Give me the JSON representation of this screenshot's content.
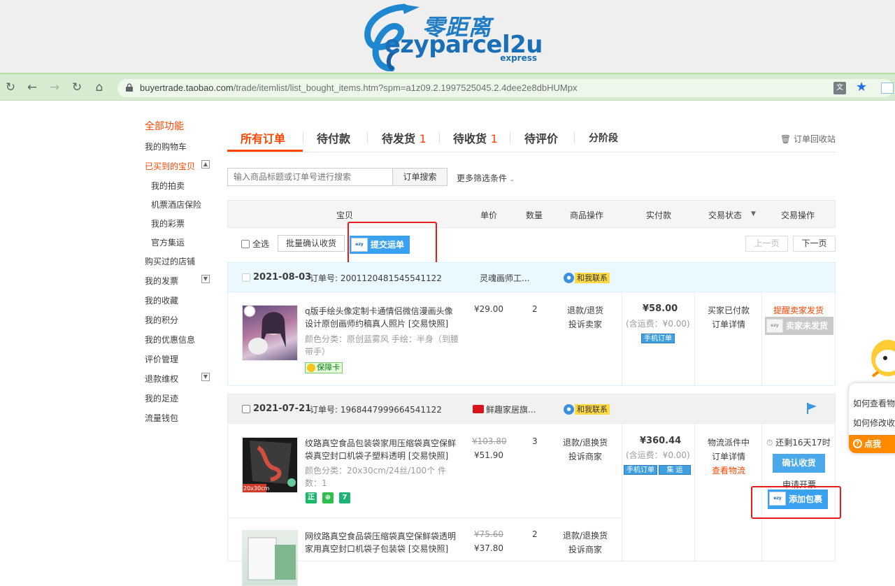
{
  "banner": {
    "logo_cn": "零距离",
    "logo_en": "ezyparcel2u",
    "logo_sub": "express"
  },
  "browser": {
    "url_host": "buyertrade.taobao.com",
    "url_path": "/trade/itemlist/list_bought_items.htm?spm=a1z09.2.1997525045.2.4dee2e8dbHUMpx"
  },
  "sidebar": {
    "all_functions": "全部功能",
    "items": [
      {
        "label": "我的购物车"
      },
      {
        "label": "已买到的宝贝"
      },
      {
        "label": "我的拍卖"
      },
      {
        "label": "机票酒店保险"
      },
      {
        "label": "我的彩票"
      },
      {
        "label": "官方集运"
      },
      {
        "label": "购买过的店铺"
      },
      {
        "label": "我的发票"
      },
      {
        "label": "我的收藏"
      },
      {
        "label": "我的积分"
      },
      {
        "label": "我的优惠信息"
      },
      {
        "label": "评价管理"
      },
      {
        "label": "退款维权"
      },
      {
        "label": "我的足迹"
      },
      {
        "label": "流量钱包"
      }
    ]
  },
  "tabs": [
    {
      "label": "所有订单",
      "count": ""
    },
    {
      "label": "待付款",
      "count": ""
    },
    {
      "label": "待发货",
      "count": "1"
    },
    {
      "label": "待收货",
      "count": "1"
    },
    {
      "label": "待评价",
      "count": ""
    },
    {
      "label": "分阶段",
      "count": ""
    }
  ],
  "recycle": "订单回收站",
  "search": {
    "placeholder": "输入商品标题或订单号进行搜索",
    "button": "订单搜索",
    "more": "更多筛选条件"
  },
  "table_header": [
    "宝贝",
    "单价",
    "数量",
    "商品操作",
    "实付款",
    "交易状态",
    "交易操作"
  ],
  "toolbar": {
    "select_all": "全选",
    "batch_confirm": "批量确认收货",
    "submit_waybill": "提交运单",
    "prev": "上一页",
    "next": "下一页"
  },
  "orders": [
    {
      "date": "2021-08-03",
      "order_no": "订单号: 2001120481545541122",
      "shop": "灵魂画师工...",
      "contact": "和我联系",
      "item": {
        "title": "q版手绘头像定制卡通情侣微信漫画头像设计原创画师约稿真人照片 [交易快照]",
        "attr": "颜色分类：原创蓝雾风  手绘：半身（到腰带手）",
        "badge": "保障卡",
        "price": "¥29.00",
        "qty": "2",
        "ops": [
          "退款/退货",
          "投诉卖家"
        ]
      },
      "total": "¥58.00",
      "shipping": "(含运费：¥0.00)",
      "mobile_tag": "手机订单",
      "status": [
        "买家已付款",
        "订单详情"
      ],
      "actions": {
        "remind": "提醒卖家发货",
        "not_shipped": "卖家未发货"
      }
    },
    {
      "date": "2021-07-21",
      "order_no": "订单号: 1968447999664541122",
      "shop": "鲜趣家居旗...",
      "contact": "和我联系",
      "items": [
        {
          "title": "纹路真空食品包装袋家用压缩袋真空保鲜袋真空封口机袋子塑料透明 [交易快照]",
          "attr": "颜色分类：20x30cm/24丝/100个  件数：1",
          "thumb_label": "20x30cm",
          "icons": [
            "正",
            "⊕",
            "7"
          ],
          "orig_price": "¥103.80",
          "price": "¥51.90",
          "qty": "3",
          "ops": [
            "退款/退换货",
            "投诉商家"
          ]
        },
        {
          "title": "网纹路真空食品袋压缩袋真空保鲜袋透明家用真空封口机袋子包装袋 [交易快照]",
          "orig_price": "¥75.60",
          "price": "¥37.80",
          "qty": "2",
          "ops": [
            "退款/退换货",
            "投诉商家"
          ]
        }
      ],
      "total": "¥360.44",
      "shipping": "(含运费：¥0.00)",
      "tags": [
        "手机订单",
        "集 运"
      ],
      "status": [
        "物流派件中",
        "订单详情",
        "查看物流"
      ],
      "actions": {
        "remaining": "还剩16天17时",
        "confirm": "确认收货",
        "invoice": "申请开票",
        "add_parcel": "添加包裹"
      }
    }
  ],
  "helper": {
    "q1": "如何查看物",
    "q2": "如何修改收",
    "btn": "点我"
  },
  "colors": {
    "accent": "#ff4400",
    "highlight": "#e81c1c",
    "blue_button": "#3aa0f0"
  }
}
